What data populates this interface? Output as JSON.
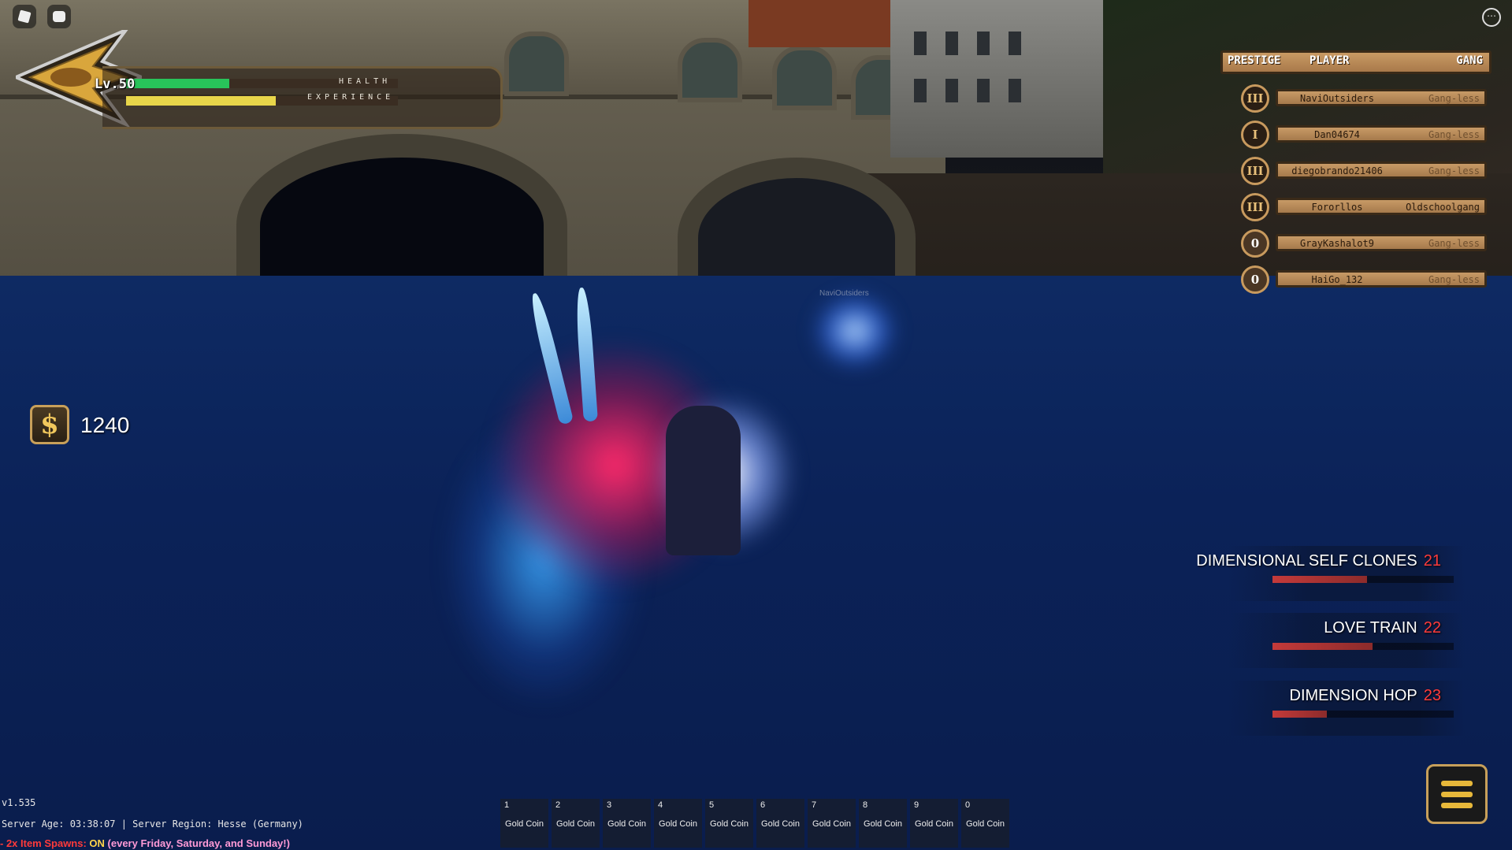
{
  "hud": {
    "level": "Lv.50",
    "health_label": "HEALTH",
    "health_fraction": 0.38,
    "exp_label": "EXPERIENCE",
    "exp_fraction": 0.55,
    "health_color": "#28c45a",
    "exp_color": "#e8d64a"
  },
  "remote_player_name": "NaviOutsiders",
  "leaderboard": {
    "header": {
      "prestige": "PRESTIGE",
      "player": "PLAYER",
      "gang": "GANG"
    },
    "rows": [
      {
        "badge": "III",
        "player": "NaviOutsiders",
        "gang": "Gang-less"
      },
      {
        "badge": "I",
        "player": "Dan04674",
        "gang": "Gang-less"
      },
      {
        "badge": "III",
        "player": "diegobrando21406",
        "gang": "Gang-less"
      },
      {
        "badge": "III",
        "player": "Fororllos",
        "gang": "Oldschoolgang"
      },
      {
        "badge": "0",
        "player": "GrayKashalot9",
        "gang": "Gang-less"
      },
      {
        "badge": "0",
        "player": "HaiGo_132",
        "gang": "Gang-less"
      }
    ]
  },
  "money": {
    "icon": "dollar-icon",
    "amount": "1240"
  },
  "skills": [
    {
      "name": "DIMENSIONAL SELF CLONES",
      "key": "21",
      "cooldown_fraction": 0.52
    },
    {
      "name": "LOVE TRAIN",
      "key": "22",
      "cooldown_fraction": 0.55
    },
    {
      "name": "DIMENSION HOP",
      "key": "23",
      "cooldown_fraction": 0.3
    }
  ],
  "hotbar": [
    {
      "key": "1",
      "item": "Gold Coin"
    },
    {
      "key": "2",
      "item": "Gold Coin"
    },
    {
      "key": "3",
      "item": "Gold Coin"
    },
    {
      "key": "4",
      "item": "Gold Coin"
    },
    {
      "key": "5",
      "item": "Gold Coin"
    },
    {
      "key": "6",
      "item": "Gold Coin"
    },
    {
      "key": "7",
      "item": "Gold Coin"
    },
    {
      "key": "8",
      "item": "Gold Coin"
    },
    {
      "key": "9",
      "item": "Gold Coin"
    },
    {
      "key": "0",
      "item": "Gold Coin"
    }
  ],
  "info": {
    "version": "v1.535",
    "server": "Server Age: 03:38:07 | Server Region: Hesse (Germany)",
    "spawns_prefix": "- 2x Item Spawns: ",
    "spawns_on": "ON",
    "spawns_days": " (every Friday, Saturday, and Sunday!)"
  },
  "icons": {
    "roblox": "roblox-logo-icon",
    "chat": "chat-icon",
    "more": "more-options-icon",
    "menu": "hamburger-menu-icon"
  }
}
